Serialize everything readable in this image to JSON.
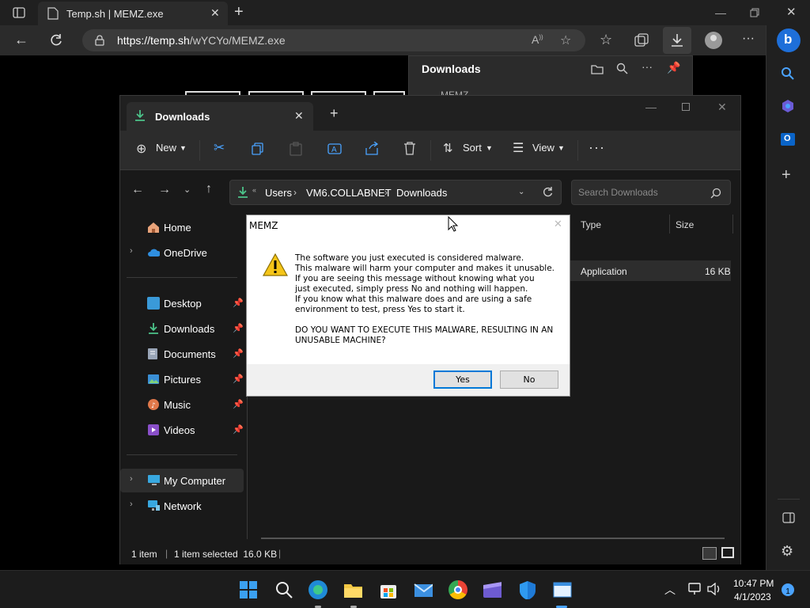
{
  "browser": {
    "tab_title": "Temp.sh | MEMZ.exe",
    "url_host": "https://temp.sh",
    "url_path": "/wYCYo/MEMZ.exe",
    "new_tab_glyph": "+"
  },
  "downloads_flyout": {
    "title": "Downloads",
    "clipped_item": "MEMZ..."
  },
  "explorer": {
    "tab_title": "Downloads",
    "commands": {
      "new": "New",
      "sort": "Sort",
      "view": "View"
    },
    "breadcrumb": [
      "Users",
      "VM6.COLLABNET",
      "Downloads"
    ],
    "search_placeholder": "Search Downloads",
    "columns": {
      "type": "Type",
      "size": "Size"
    },
    "file_row": {
      "type": "Application",
      "size": "16 KB"
    },
    "nav": {
      "home": "Home",
      "onedrive": "OneDrive",
      "desktop": "Desktop",
      "downloads": "Downloads",
      "documents": "Documents",
      "pictures": "Pictures",
      "music": "Music",
      "videos": "Videos",
      "my_computer": "My Computer",
      "network": "Network"
    },
    "status": {
      "count": "1 item",
      "selected": "1 item selected  16.0 KB"
    }
  },
  "dialog": {
    "title": "MEMZ",
    "message": "The software you just executed is considered malware.\nThis malware will harm your computer and makes it unusable.\nIf you are seeing this message without knowing what you\njust executed, simply press No and nothing will happen.\nIf you know what this malware does and are using a safe\nenvironment to test, press Yes to start it.\n\nDO YOU WANT TO EXECUTE THIS MALWARE, RESULTING IN AN\nUNUSABLE MACHINE?",
    "yes_label": "Yes",
    "no_label": "No"
  },
  "taskbar": {
    "time": "10:47 PM",
    "date": "4/1/2023",
    "notification_count": "1"
  },
  "colors": {
    "accent": "#0078d7",
    "download_green": "#4cc38a",
    "edge_chrome": "#2b2b2b"
  }
}
